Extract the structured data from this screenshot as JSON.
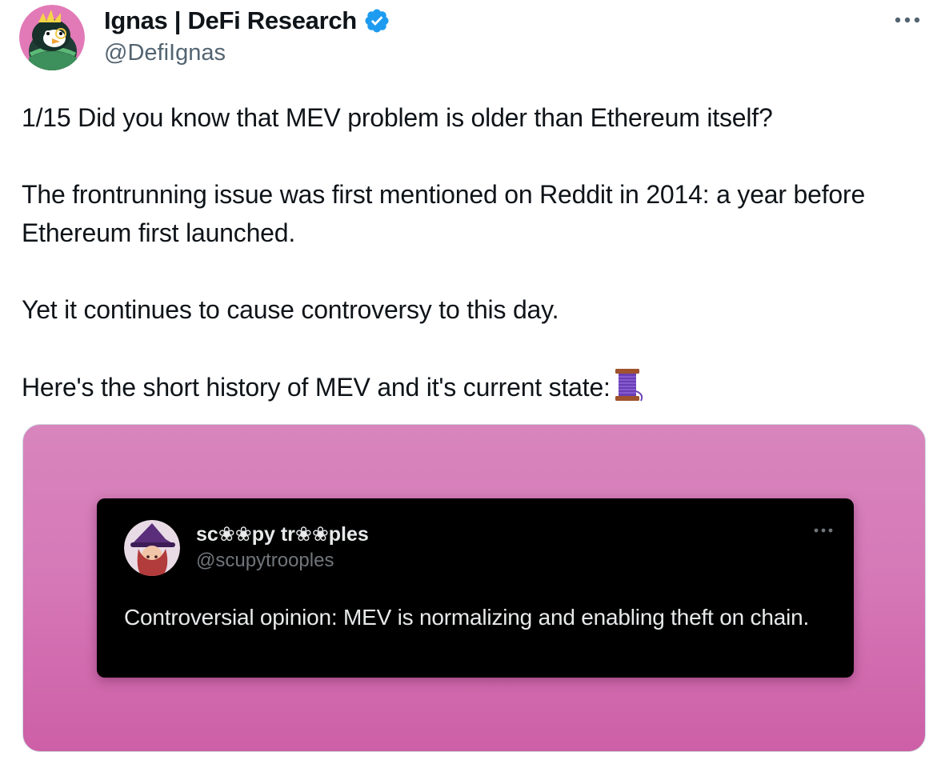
{
  "tweet": {
    "author": {
      "display_name": "Ignas | DeFi Research",
      "handle": "@DefiIgnas",
      "verified": true,
      "avatar_icon": "penguin-avatar-icon"
    },
    "more_icon": "more-horizontal-icon",
    "paragraphs": [
      "1/15 Did you know that MEV problem is older than Ethereum itself?",
      "The frontrunning issue was first mentioned on Reddit in 2014: a year before Ethereum first launched.",
      "Yet it continues to cause controversy to this day.",
      "Here's the short history of MEV and it's current state:"
    ],
    "thread_emoji_icon": "spool-of-thread-icon",
    "media": {
      "background_colors": [
        "#d885bd",
        "#cd5fa6"
      ],
      "quoted_tweet": {
        "display_name": "sc❀❀py tr❀❀ples",
        "handle": "@scupytrooples",
        "text": "Controversial opinion: MEV is normalizing and enabling theft on chain.",
        "avatar_icon": "witch-avatar-icon",
        "more_icon": "more-horizontal-icon"
      }
    }
  },
  "colors": {
    "text_primary": "#0f1419",
    "text_secondary": "#536471",
    "verified_blue": "#1d9bf0",
    "quoted_background": "#000000"
  }
}
